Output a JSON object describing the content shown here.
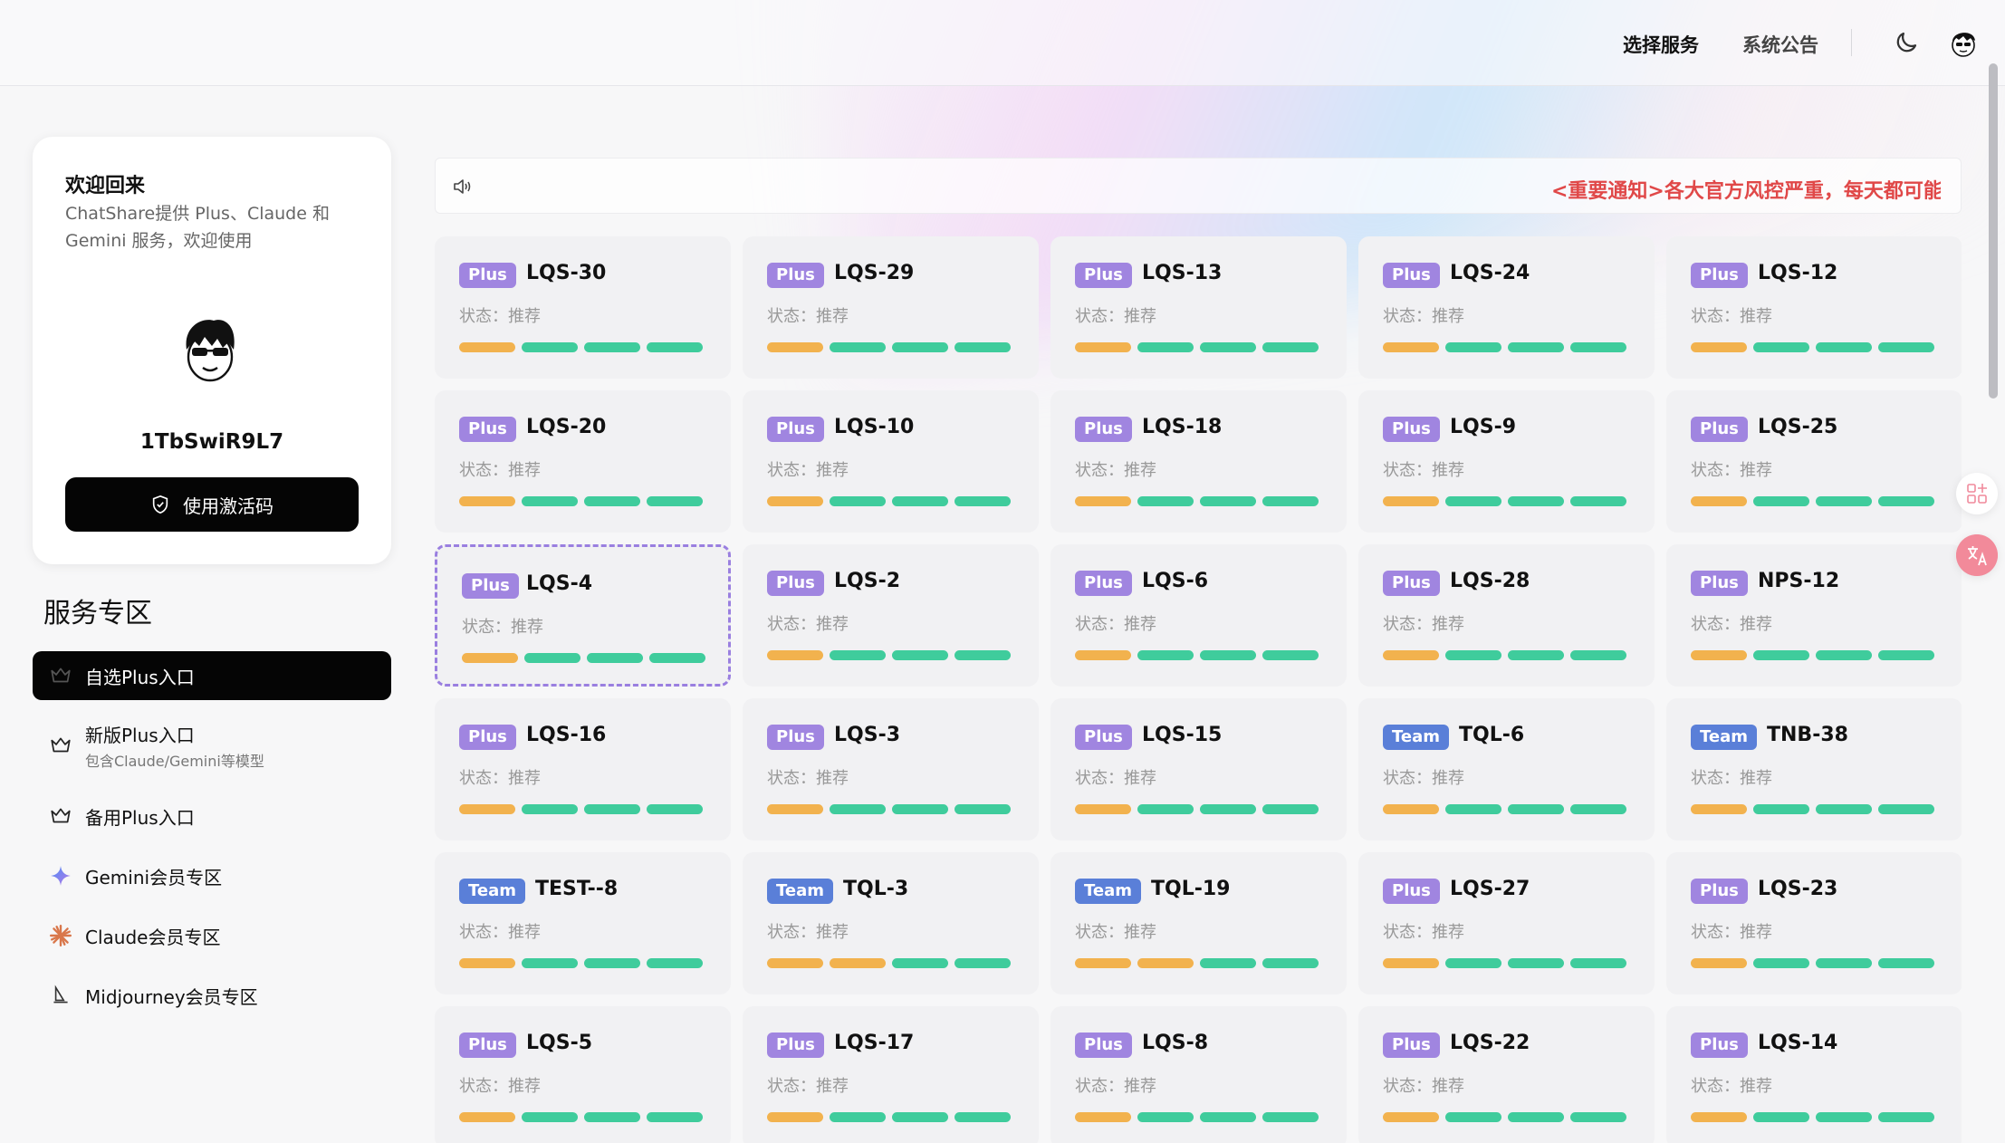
{
  "header": {
    "nav_select": "选择服务",
    "nav_notice": "系统公告"
  },
  "welcome": {
    "title": "欢迎回来",
    "description": "ChatShare提供 Plus、Claude 和 Gemini 服务，欢迎使用",
    "username": "1TbSwiR9L7",
    "activate_button": "使用激活码"
  },
  "sidebar": {
    "section_title": "服务专区",
    "items": [
      {
        "label": "自选Plus入口",
        "sub": "",
        "icon": "crown-icon",
        "active": true
      },
      {
        "label": "新版Plus入口",
        "sub": "包含Claude/Gemini等模型",
        "icon": "crown-icon",
        "active": false
      },
      {
        "label": "备用Plus入口",
        "sub": "",
        "icon": "crown-icon",
        "active": false
      },
      {
        "label": "Gemini会员专区",
        "sub": "",
        "icon": "gemini-sparkle-icon",
        "active": false
      },
      {
        "label": "Claude会员专区",
        "sub": "",
        "icon": "claude-starburst-icon",
        "active": false
      },
      {
        "label": "Midjourney会员专区",
        "sub": "",
        "icon": "midjourney-sail-icon",
        "active": false
      }
    ]
  },
  "notice": {
    "text": "<重要通知>各大官方风控严重，每天都可能"
  },
  "status_label": "状态：推荐",
  "colors": {
    "plus_badge": "#a085e0",
    "team_badge": "#5a7fd8",
    "bar_orange": "#f2b24e",
    "bar_green": "#3fcc9c",
    "notice_red": "#e04848"
  },
  "cards": [
    {
      "type": "Plus",
      "name": "LQS-30",
      "bars": [
        "o",
        "g",
        "g",
        "g"
      ]
    },
    {
      "type": "Plus",
      "name": "LQS-29",
      "bars": [
        "o",
        "g",
        "g",
        "g"
      ]
    },
    {
      "type": "Plus",
      "name": "LQS-13",
      "bars": [
        "o",
        "g",
        "g",
        "g"
      ]
    },
    {
      "type": "Plus",
      "name": "LQS-24",
      "bars": [
        "o",
        "g",
        "g",
        "g"
      ]
    },
    {
      "type": "Plus",
      "name": "LQS-12",
      "bars": [
        "o",
        "g",
        "g",
        "g"
      ]
    },
    {
      "type": "Plus",
      "name": "LQS-20",
      "bars": [
        "o",
        "g",
        "g",
        "g"
      ]
    },
    {
      "type": "Plus",
      "name": "LQS-10",
      "bars": [
        "o",
        "g",
        "g",
        "g"
      ]
    },
    {
      "type": "Plus",
      "name": "LQS-18",
      "bars": [
        "o",
        "g",
        "g",
        "g"
      ]
    },
    {
      "type": "Plus",
      "name": "LQS-9",
      "bars": [
        "o",
        "g",
        "g",
        "g"
      ]
    },
    {
      "type": "Plus",
      "name": "LQS-25",
      "bars": [
        "o",
        "g",
        "g",
        "g"
      ]
    },
    {
      "type": "Plus",
      "name": "LQS-4",
      "bars": [
        "o",
        "g",
        "g",
        "g"
      ],
      "selected": true
    },
    {
      "type": "Plus",
      "name": "LQS-2",
      "bars": [
        "o",
        "g",
        "g",
        "g"
      ]
    },
    {
      "type": "Plus",
      "name": "LQS-6",
      "bars": [
        "o",
        "g",
        "g",
        "g"
      ]
    },
    {
      "type": "Plus",
      "name": "LQS-28",
      "bars": [
        "o",
        "g",
        "g",
        "g"
      ]
    },
    {
      "type": "Plus",
      "name": "NPS-12",
      "bars": [
        "o",
        "g",
        "g",
        "g"
      ]
    },
    {
      "type": "Plus",
      "name": "LQS-16",
      "bars": [
        "o",
        "g",
        "g",
        "g"
      ]
    },
    {
      "type": "Plus",
      "name": "LQS-3",
      "bars": [
        "o",
        "g",
        "g",
        "g"
      ]
    },
    {
      "type": "Plus",
      "name": "LQS-15",
      "bars": [
        "o",
        "g",
        "g",
        "g"
      ]
    },
    {
      "type": "Team",
      "name": "TQL-6",
      "bars": [
        "o",
        "g",
        "g",
        "g"
      ]
    },
    {
      "type": "Team",
      "name": "TNB-38",
      "bars": [
        "o",
        "g",
        "g",
        "g"
      ]
    },
    {
      "type": "Team",
      "name": "TEST--8",
      "bars": [
        "o",
        "g",
        "g",
        "g"
      ]
    },
    {
      "type": "Team",
      "name": "TQL-3",
      "bars": [
        "o",
        "o",
        "g",
        "g"
      ]
    },
    {
      "type": "Team",
      "name": "TQL-19",
      "bars": [
        "o",
        "o",
        "g",
        "g"
      ]
    },
    {
      "type": "Plus",
      "name": "LQS-27",
      "bars": [
        "o",
        "g",
        "g",
        "g"
      ]
    },
    {
      "type": "Plus",
      "name": "LQS-23",
      "bars": [
        "o",
        "g",
        "g",
        "g"
      ]
    },
    {
      "type": "Plus",
      "name": "LQS-5",
      "bars": [
        "o",
        "g",
        "g",
        "g"
      ]
    },
    {
      "type": "Plus",
      "name": "LQS-17",
      "bars": [
        "o",
        "g",
        "g",
        "g"
      ]
    },
    {
      "type": "Plus",
      "name": "LQS-8",
      "bars": [
        "o",
        "g",
        "g",
        "g"
      ]
    },
    {
      "type": "Plus",
      "name": "LQS-22",
      "bars": [
        "o",
        "g",
        "g",
        "g"
      ]
    },
    {
      "type": "Plus",
      "name": "LQS-14",
      "bars": [
        "o",
        "g",
        "g",
        "g"
      ]
    }
  ]
}
